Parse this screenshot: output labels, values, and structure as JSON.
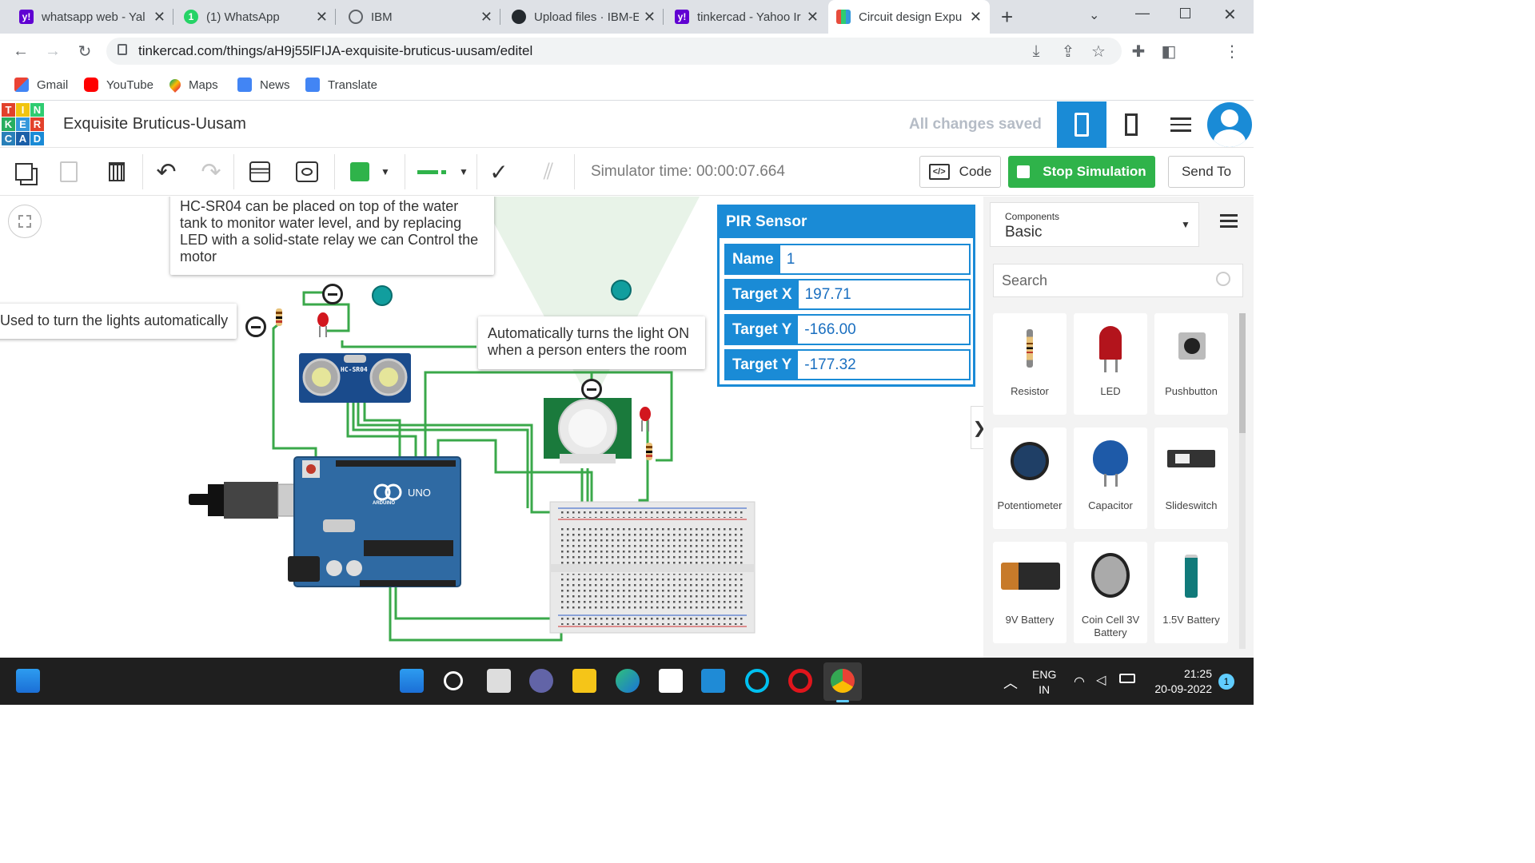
{
  "browser": {
    "tabs": [
      {
        "title": "whatsapp web - Yal",
        "icon": "yahoo-icon"
      },
      {
        "title": "(1) WhatsApp",
        "icon": "whatsapp-icon"
      },
      {
        "title": "IBM",
        "icon": "globe-icon"
      },
      {
        "title": "Upload files · IBM-E",
        "icon": "github-icon"
      },
      {
        "title": "tinkercad - Yahoo Ir",
        "icon": "yahoo-icon"
      },
      {
        "title": "Circuit design Expu",
        "icon": "tinkercad-icon",
        "active": true
      }
    ],
    "url": "tinkercad.com/things/aH9j55lFIJA-exquisite-bruticus-uusam/editel",
    "bookmarks": [
      {
        "label": "Gmail",
        "icon": "gmail-icon"
      },
      {
        "label": "YouTube",
        "icon": "youtube-icon"
      },
      {
        "label": "Maps",
        "icon": "maps-icon"
      },
      {
        "label": "News",
        "icon": "news-icon"
      },
      {
        "label": "Translate",
        "icon": "translate-icon"
      }
    ]
  },
  "app": {
    "logo_letters": [
      "T",
      "I",
      "N",
      "K",
      "E",
      "R",
      "C",
      "A",
      "D"
    ],
    "project_title": "Exquisite Bruticus-Uusam",
    "save_status": "All changes saved",
    "simulator_time": "Simulator time: 00:00:07.664",
    "code_label": "Code",
    "stop_label": "Stop Simulation",
    "send_label": "Send To"
  },
  "workspace": {
    "notes": {
      "hcsr04": "HC-SR04 can be placed on top of the water tank to monitor water level, and by replacing LED with a solid-state relay we can Control the motor",
      "lights": "Used to turn the lights automatically",
      "pir": "Automatically turns the light ON when a person enters the room"
    },
    "sensor_label": "HC-SR04",
    "arduino_label": "UNO",
    "arduino_brand": "ARDUINO"
  },
  "pir_panel": {
    "title": "PIR Sensor",
    "rows": [
      {
        "label": "Name",
        "value": "1"
      },
      {
        "label": "Target X",
        "value": "197.71"
      },
      {
        "label": "Target Y",
        "value": "-166.00"
      },
      {
        "label": "Target Y",
        "value": "-177.32"
      }
    ]
  },
  "components": {
    "header_label": "Components",
    "category": "Basic",
    "search_placeholder": "Search",
    "items": [
      {
        "label": "Resistor"
      },
      {
        "label": "LED"
      },
      {
        "label": "Pushbutton"
      },
      {
        "label": "Potentiometer"
      },
      {
        "label": "Capacitor"
      },
      {
        "label": "Slideswitch"
      },
      {
        "label": "9V Battery"
      },
      {
        "label": "Coin Cell 3V Battery"
      },
      {
        "label": "1.5V Battery"
      }
    ]
  },
  "taskbar": {
    "lang1": "ENG",
    "lang2": "IN",
    "time": "21:25",
    "date": "20-09-2022",
    "notif_count": "1"
  },
  "colors": {
    "accent": "#1a8bd6",
    "stop_green": "#2fb34a",
    "wire_green": "#3aa84a",
    "arduino_blue": "#2f6aa3"
  }
}
